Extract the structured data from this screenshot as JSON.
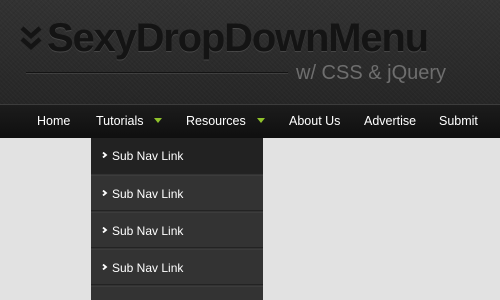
{
  "header": {
    "title": "SexyDropDownMenu",
    "subtitle": "w/ CSS & jQuery"
  },
  "nav": {
    "items": [
      {
        "label": "Home",
        "has_arrow": false
      },
      {
        "label": "Tutorials",
        "has_arrow": true
      },
      {
        "label": "Resources",
        "has_arrow": true
      },
      {
        "label": "About Us",
        "has_arrow": false
      },
      {
        "label": "Advertise",
        "has_arrow": false
      },
      {
        "label": "Submit",
        "has_arrow": false
      }
    ],
    "arrow_color": "#8fc22b"
  },
  "dropdown": {
    "items": [
      {
        "label": "Sub Nav Link"
      },
      {
        "label": "Sub Nav Link"
      },
      {
        "label": "Sub Nav Link"
      },
      {
        "label": "Sub Nav Link"
      }
    ]
  },
  "icons": {
    "logo": "double-chevron-down-icon",
    "nav_arrow": "triangle-down-icon",
    "dropdown_bullet": "chevron-right-icon"
  }
}
